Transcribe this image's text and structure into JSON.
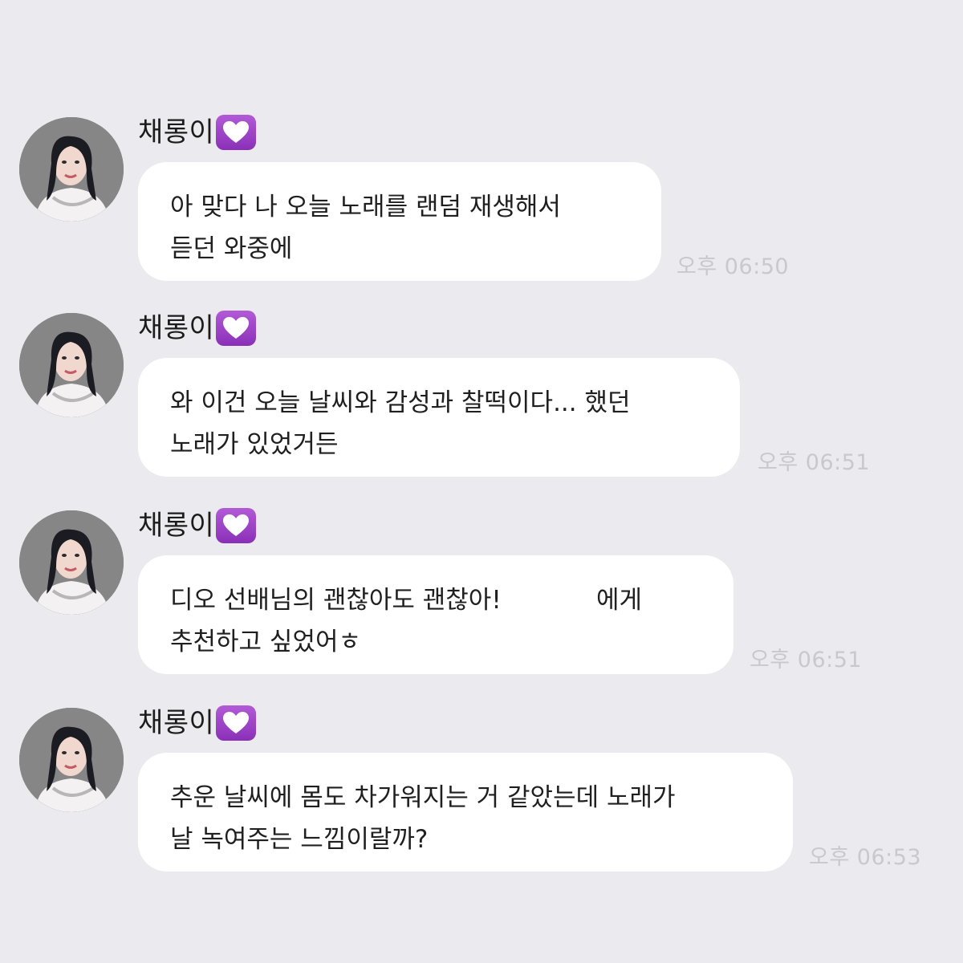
{
  "messages": [
    {
      "sender": "채롱이",
      "lines": [
        "아 맞다 나 오늘 노래를 랜덤 재생해서",
        "듣던 와중에"
      ],
      "time": "오후 06:50"
    },
    {
      "sender": "채롱이",
      "lines": [
        "와 이건 오늘 날씨와 감성과 찰떡이다... 했던",
        "노래가 있었거든"
      ],
      "time": "오후 06:51"
    },
    {
      "sender": "채롱이",
      "lines": [
        "디오 선배님의 괜찮아도 괜찮아!            에게",
        "추천하고 싶었어ㅎ"
      ],
      "time": "오후 06:51"
    },
    {
      "sender": "채롱이",
      "lines": [
        "추운 날씨에 몸도 차가워지는 거 같았는데 노래가",
        "날 녹여주는 느낌이랄까?"
      ],
      "time": "오후 06:53"
    }
  ],
  "colors": {
    "background": "#ebeaee",
    "bubble": "#ffffff",
    "heart_badge": "#9b44c8",
    "timestamp": "#c9c8cc"
  },
  "icons": {
    "sender_badge": "purple-heart-icon"
  }
}
